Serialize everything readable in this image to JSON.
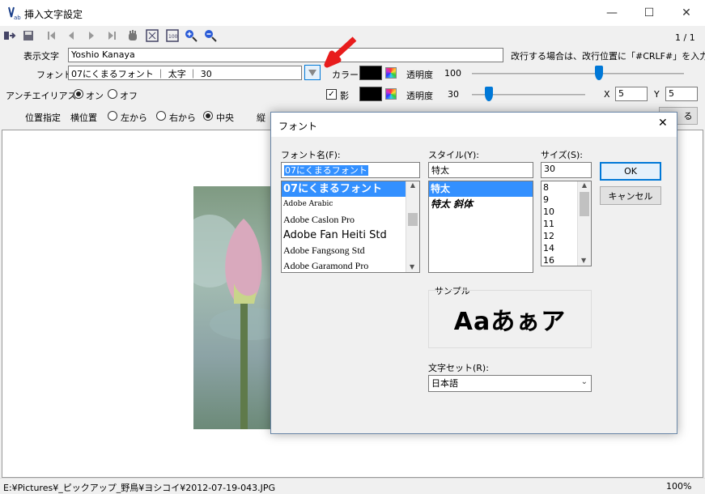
{
  "window": {
    "title": "挿入文字設定",
    "minimize": "—",
    "maximize": "☐",
    "close": "✕"
  },
  "toolbar": {
    "page_counter": "1 / 1",
    "icons": [
      "import-icon",
      "save-icon",
      "first-page-icon",
      "prev-icon",
      "next-icon",
      "last-page-icon",
      "hand-icon",
      "fit-icon",
      "actual-size-icon",
      "zoom-in-icon",
      "zoom-out-icon"
    ]
  },
  "settings": {
    "display_text_label": "表示文字",
    "display_text_value": "Yoshio Kanaya",
    "newline_hint": "改行する場合は、改行位置に「#CRLF#」を入力",
    "font_label": "フォント",
    "font_value": "07にくまるフォント ｜ 太字 ｜ 30",
    "color_label": "カラー",
    "opacity_label": "透明度",
    "opacity_value": "100",
    "antialias_label": "アンチエイリアス",
    "antialias_on": "オン",
    "antialias_off": "オフ",
    "shadow_label": "影",
    "shadow_checked": "✓",
    "shadow_opacity_label": "透明度",
    "shadow_opacity_value": "30",
    "x_label": "X",
    "x_value": "5",
    "y_label": "Y",
    "y_value": "5",
    "position_label": "位置指定",
    "horizontal_label": "横位置",
    "h_left": "左から",
    "h_right": "右から",
    "h_center": "中央",
    "vertical_label": "縦",
    "cut_button": "る",
    "opacity_level": 0.6,
    "shadow_opacity_level": 0.06
  },
  "font_dialog": {
    "title": "フォント",
    "font_name_label": "フォント名(F):",
    "font_name_value": "07にくまるフォント",
    "fonts": [
      "07にくまるフォント",
      "Adobe Arabic",
      "Adobe Caslon Pro",
      "Adobe Fan Heiti Std",
      "Adobe Fangsong Std",
      "Adobe Garamond Pro"
    ],
    "style_label": "スタイル(Y):",
    "style_value": "特太",
    "styles": [
      "特太",
      "特太 斜体"
    ],
    "size_label": "サイズ(S):",
    "size_value": "30",
    "sizes": [
      "8",
      "9",
      "10",
      "11",
      "12",
      "14",
      "16"
    ],
    "ok": "OK",
    "cancel": "キャンセル",
    "sample_label": "サンプル",
    "sample_text": "Aaあぁア",
    "charset_label": "文字セット(R):",
    "charset_value": "日本語"
  },
  "status": {
    "path": "E:¥Pictures¥_ピックアップ_野鳥¥ヨシコイ¥2012-07-19-043.JPG",
    "zoom": "100%"
  },
  "colors": {
    "accent": "#0078d7",
    "selection": "#3390ff",
    "arrow": "#e81c1c"
  }
}
